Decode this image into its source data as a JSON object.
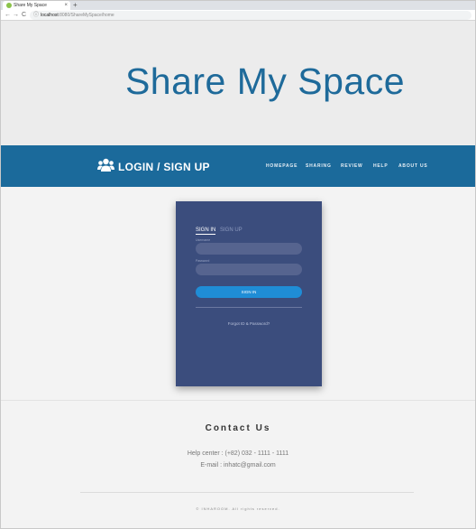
{
  "browser": {
    "tab_title": "Share My Space",
    "close_glyph": "×",
    "new_tab_glyph": "+",
    "url_host": "localhost",
    "url_path": ":8080/ShareMySpace/home",
    "back_glyph": "←",
    "forward_glyph": "→",
    "reload_glyph": "C",
    "info_glyph": "ⓘ"
  },
  "hero": {
    "title": "Share My Space"
  },
  "band": {
    "title": "LOGIN / SIGN UP",
    "icon": "users-icon",
    "nav": [
      "HOMEPAGE",
      "SHARING",
      "REVIEW",
      "HELP",
      "ABOUT US"
    ]
  },
  "login": {
    "tab_signin": "SIGN IN",
    "tab_signup": "SIGN UP",
    "username_label": "Username",
    "password_label": "Password",
    "signin_button": "SIGN IN",
    "forgot": "Forgot ID & Password?"
  },
  "footer": {
    "contact_title": "Contact Us",
    "help": "Help center : (+82) 032 - 1111 - 1111",
    "email": "E-mail : inhatc@gmail.com",
    "copyright": "© INHAROOM. All rights reserved."
  },
  "colors": {
    "brand_blue": "#1b6a9b",
    "card": "#3b4d7d",
    "button": "#1f8dd6"
  }
}
